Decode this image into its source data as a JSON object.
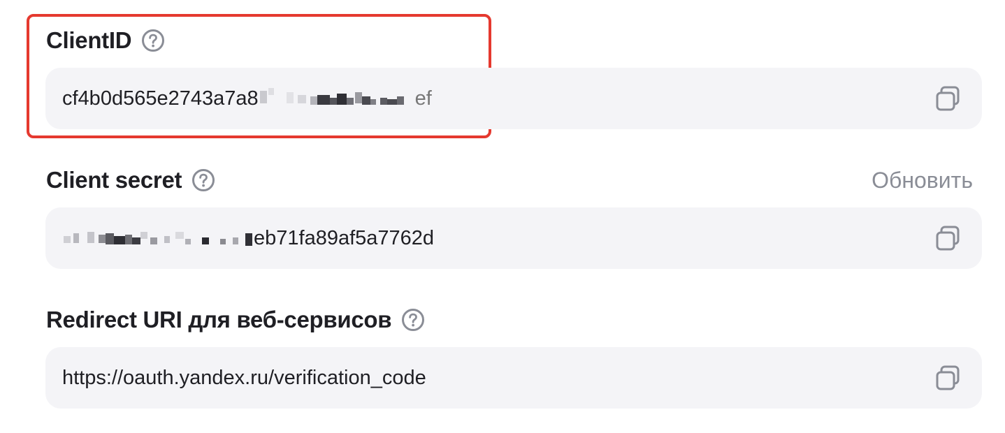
{
  "colors": {
    "field_background": "#f4f4f7",
    "text": "#1f1f24",
    "muted_text": "#8a8d96",
    "icon": "#8a8d96",
    "highlight_border": "#e5392f"
  },
  "client_id": {
    "label": "ClientID",
    "value_visible_prefix": "cf4b0d565e2743a7a8",
    "value_visible_suffix": "ef",
    "value_obscured": true,
    "help_icon": "question-circle-icon",
    "copy_icon": "copy-icon"
  },
  "client_secret": {
    "label": "Client secret",
    "refresh_label": "Обновить",
    "value_visible_suffix": "eb71fa89af5a7762d",
    "value_obscured": true,
    "help_icon": "question-circle-icon",
    "copy_icon": "copy-icon"
  },
  "redirect_uri": {
    "label": "Redirect URI для веб-сервисов",
    "value": "https://oauth.yandex.ru/verification_code",
    "help_icon": "question-circle-icon",
    "copy_icon": "copy-icon"
  }
}
